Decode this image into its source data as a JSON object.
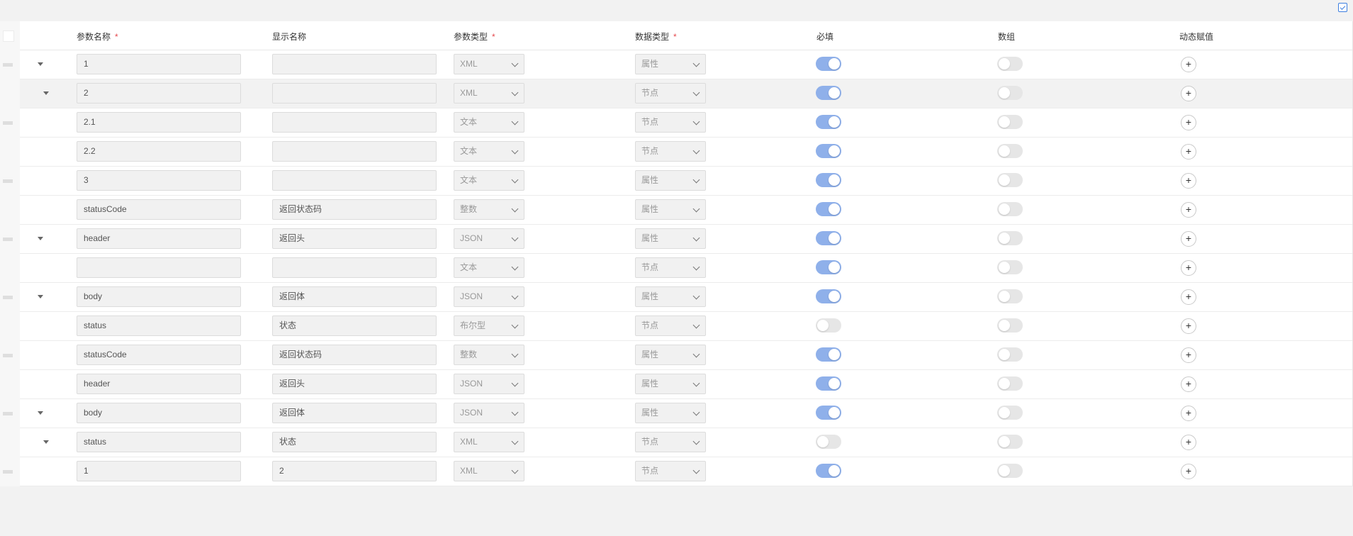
{
  "table": {
    "columns": {
      "param_name": "参数名称",
      "display_name": "显示名称",
      "param_type": "参数类型",
      "data_type": "数据类型",
      "required": "必填",
      "array": "数组",
      "dynamic": "动态赋值"
    },
    "required_mark": "*",
    "colors": {
      "toggle_on": "#8fb0ea",
      "toggle_off": "#e6e6e6",
      "required_mark": "#e5484d",
      "accent": "#3d7fe0"
    },
    "rows": [
      {
        "name": "1",
        "display": "",
        "param_type": "XML",
        "data_type": "属性",
        "required": true,
        "array": false,
        "expandable": true,
        "depth": 0,
        "highlight": false
      },
      {
        "name": "2",
        "display": "",
        "param_type": "XML",
        "data_type": "节点",
        "required": true,
        "array": false,
        "expandable": true,
        "depth": 1,
        "highlight": true
      },
      {
        "name": "2.1",
        "display": "",
        "param_type": "文本",
        "data_type": "节点",
        "required": true,
        "array": false,
        "expandable": false,
        "depth": 2,
        "highlight": false
      },
      {
        "name": "2.2",
        "display": "",
        "param_type": "文本",
        "data_type": "节点",
        "required": true,
        "array": false,
        "expandable": false,
        "depth": 2,
        "highlight": false
      },
      {
        "name": "3",
        "display": "",
        "param_type": "文本",
        "data_type": "属性",
        "required": true,
        "array": false,
        "expandable": false,
        "depth": 0,
        "highlight": false
      },
      {
        "name": "statusCode",
        "display": "返回状态码",
        "param_type": "整数",
        "data_type": "属性",
        "required": true,
        "array": false,
        "expandable": false,
        "depth": 0,
        "highlight": false
      },
      {
        "name": "header",
        "display": "返回头",
        "param_type": "JSON",
        "data_type": "属性",
        "required": true,
        "array": false,
        "expandable": true,
        "depth": 0,
        "highlight": false
      },
      {
        "name": "",
        "display": "",
        "param_type": "文本",
        "data_type": "节点",
        "required": true,
        "array": false,
        "expandable": false,
        "depth": 1,
        "highlight": false
      },
      {
        "name": "body",
        "display": "返回体",
        "param_type": "JSON",
        "data_type": "属性",
        "required": true,
        "array": false,
        "expandable": true,
        "depth": 0,
        "highlight": false
      },
      {
        "name": "status",
        "display": "状态",
        "param_type": "布尔型",
        "data_type": "节点",
        "required": false,
        "array": false,
        "expandable": false,
        "depth": 1,
        "highlight": false
      },
      {
        "name": "statusCode",
        "display": "返回状态码",
        "param_type": "整数",
        "data_type": "属性",
        "required": true,
        "array": false,
        "expandable": false,
        "depth": 1,
        "highlight": false
      },
      {
        "name": "header",
        "display": "返回头",
        "param_type": "JSON",
        "data_type": "属性",
        "required": true,
        "array": false,
        "expandable": false,
        "depth": 1,
        "highlight": false
      },
      {
        "name": "body",
        "display": "返回体",
        "param_type": "JSON",
        "data_type": "属性",
        "required": true,
        "array": false,
        "expandable": true,
        "depth": 0,
        "highlight": false
      },
      {
        "name": "status",
        "display": "状态",
        "param_type": "XML",
        "data_type": "节点",
        "required": false,
        "array": false,
        "expandable": true,
        "depth": 1,
        "highlight": false
      },
      {
        "name": "1",
        "display": "2",
        "param_type": "XML",
        "data_type": "节点",
        "required": true,
        "array": false,
        "expandable": false,
        "depth": 2,
        "highlight": false
      }
    ],
    "add_icon": "plus-icon",
    "expand_icon": "caret-down-icon",
    "select_icon": "chevron-down-icon"
  }
}
